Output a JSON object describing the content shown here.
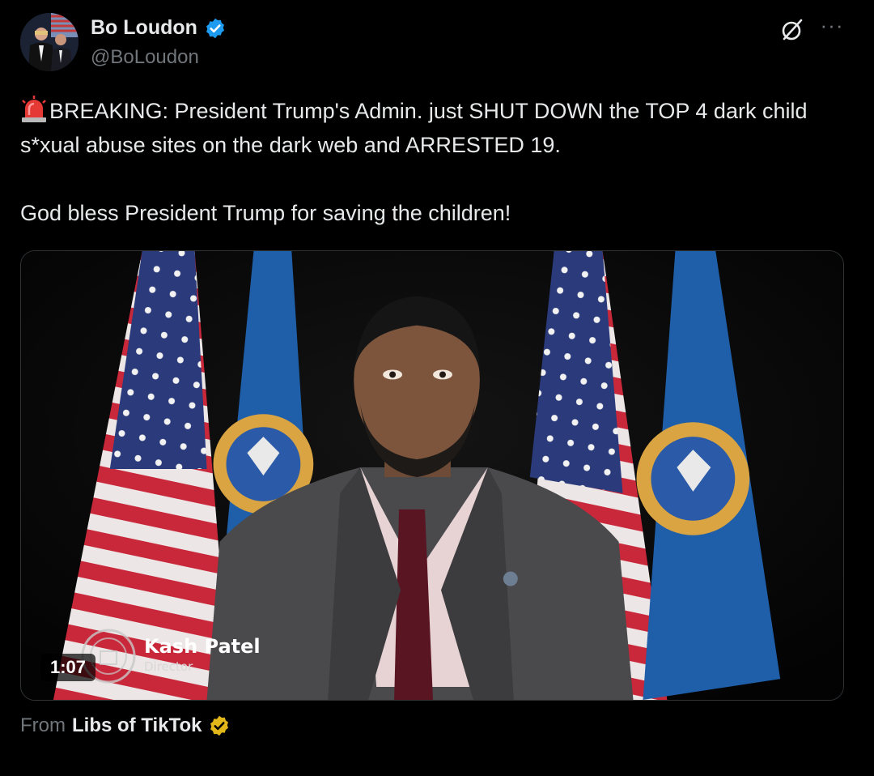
{
  "author": {
    "display_name": "Bo Loudon",
    "handle": "@BoLoudon"
  },
  "tweet": {
    "paragraphs": [
      "BREAKING: President Trump's Admin. just SHUT DOWN the TOP 4 dark child s*xual abuse sites on the dark web and ARRESTED 19.",
      "God bless President Trump for saving the children!"
    ]
  },
  "media": {
    "duration": "1:07",
    "lower_third_name": "Kash Patel",
    "lower_third_title": "Director"
  },
  "source": {
    "prefix": "From",
    "account": "Libs of TikTok"
  },
  "colors": {
    "background": "#000000",
    "text": "#e7e9ea",
    "muted": "#71767b",
    "verified_blue": "#1d9bf0",
    "verified_gold": "#e2b719"
  },
  "icons": {
    "verified": "verified-badge-icon",
    "grok": "grok-icon",
    "more": "more-icon",
    "siren": "siren-emoji"
  }
}
